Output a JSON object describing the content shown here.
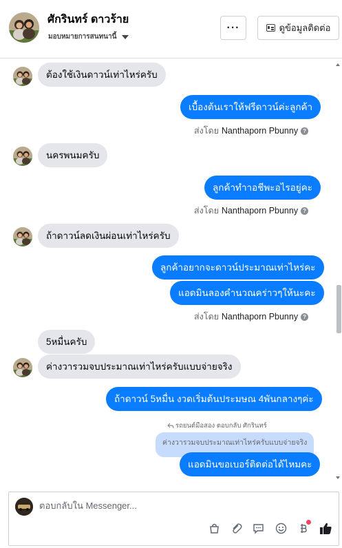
{
  "header": {
    "name": "ศักรินทร์ ดาวร้าย",
    "subtitle": "มอบหมายการสนทนานี้",
    "more_label": "···",
    "info_label": "ดูข้อมูลติดต่อ"
  },
  "messages": {
    "m1": "ต้องใช้เงินดาวน์เท่าไหร่ครับ",
    "m2": "เบื้องต้นเราให้ฟรีดาวน์ค่ะลูกค้า",
    "m3": "นครพนมครับ",
    "m4": "ลูกค้าทำาอชีพะอไรอยู่คะ",
    "m5": "ถ้าดาวน์ลดเงินผ่อนเท่าไหร่ครับ",
    "m6": "ลูกค้าอยากจะดาวน์ประมาณเท่าไหร่คะ",
    "m7": "แอดมินลองคำนวณคร่าวๆให้นะคะ",
    "m8": "5หมื่นครับ",
    "m9": "ค่างวารวมจบประมาณเท่าไหร่ครับแบบจ่ายจริง",
    "m10": "ถ้าดาวน์ 5หมื่น งวดเริ่มต้นประมษณ 4พันกลางๆค่ะ",
    "m11": "แอดมินขอเบอร์ติดต่อได้ไหมคะ"
  },
  "sent_by": {
    "prefix": "ส่งโดย",
    "agent": "Nanthaporn Pbunny"
  },
  "reply_context": {
    "note": "รถยนต์มือสอง ตอบกลับ ศักรินทร์",
    "quoted": "ค่างวารวมจบประมาณเท่าไหร่ครับแบบจ่ายจริง"
  },
  "composer": {
    "placeholder": "ตอบกลับใน Messenger..."
  },
  "icons": {
    "more": "more-dots-icon",
    "contact": "id-card-icon",
    "help": "question-mark-icon",
    "shop": "shopping-bag-icon",
    "attach": "paperclip-icon",
    "saved_reply": "chat-bubble-icon",
    "emoji": "smiley-icon",
    "payment": "baht-icon",
    "like": "thumbs-up-icon"
  },
  "colors": {
    "outgoing_bubble": "#0a7cff",
    "incoming_bubble": "#e4e6eb",
    "quote_bubble": "#c7dcfd",
    "like_icon": "#0a7cff"
  }
}
